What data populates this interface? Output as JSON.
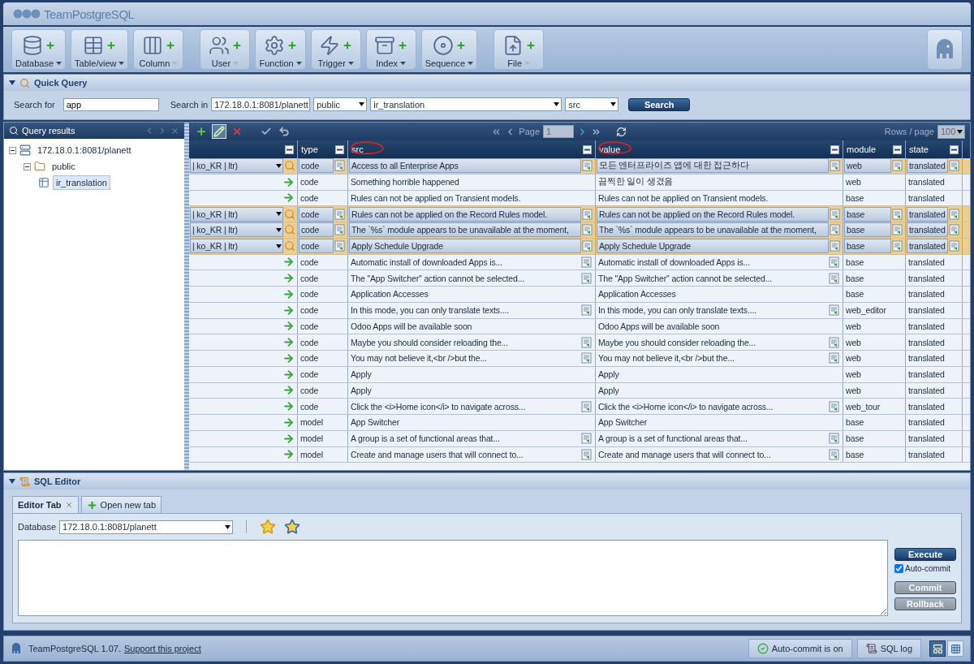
{
  "app": {
    "title": "TeamPostgreSQL"
  },
  "toolbar": [
    {
      "label": "Database",
      "menu_enabled": true
    },
    {
      "label": "Table/view",
      "menu_enabled": true
    },
    {
      "label": "Column",
      "menu_enabled": false
    },
    {
      "label": "User",
      "menu_enabled": false
    },
    {
      "label": "Function",
      "menu_enabled": true
    },
    {
      "label": "Trigger",
      "menu_enabled": true
    },
    {
      "label": "Index",
      "menu_enabled": true
    },
    {
      "label": "Sequence",
      "menu_enabled": true
    },
    {
      "label": "File",
      "menu_enabled": false
    }
  ],
  "quick_query": {
    "title": "Quick Query",
    "expanded": true,
    "search_for_label": "Search for",
    "search_for_value": "app",
    "search_in_label": "Search in",
    "selects": [
      "172.18.0.1:8081/planett",
      "public",
      "ir_translation",
      "src"
    ],
    "button": "Search"
  },
  "results_panel": {
    "title": "Query results",
    "tree": [
      {
        "label": "172.18.0.1:8081/planett",
        "kind": "server",
        "expanded": true,
        "selected": false,
        "children": [
          {
            "label": "public",
            "kind": "schema",
            "expanded": true,
            "selected": false,
            "children": [
              {
                "label": "ir_translation",
                "kind": "table",
                "selected": true
              }
            ]
          }
        ]
      }
    ]
  },
  "grid": {
    "tools": [
      {
        "kind": "add",
        "active": false
      },
      {
        "kind": "edit",
        "active": true
      },
      {
        "kind": "delete",
        "active": false
      },
      {
        "kind": "save",
        "active": false
      },
      {
        "kind": "undo",
        "active": false
      }
    ],
    "page_label": "Page",
    "page_value": "1",
    "rows_per_page_label": "Rows / page",
    "rows_per_page": "100",
    "columns": [
      {
        "label": "type",
        "circled": false
      },
      {
        "label": "src",
        "circled": true
      },
      {
        "label": "value",
        "circled": true
      },
      {
        "label": "module",
        "circled": false
      },
      {
        "label": "state",
        "circled": false
      }
    ],
    "rows": [
      {
        "editing": true,
        "locale": "| ko_KR | ltr)",
        "type": "code",
        "src": "Access to all Enterprise Apps",
        "value": "모든 엔터프라이즈 앱에 대한 접근하다",
        "module": "web",
        "state": "translated",
        "has_note": true
      },
      {
        "editing": false,
        "type": "code",
        "src": "Something horrible happened",
        "value": "끔찍한 일이 생겼음",
        "module": "web",
        "state": "translated",
        "has_note": false
      },
      {
        "editing": false,
        "type": "code",
        "src": "Rules can not be applied on Transient models.",
        "value": "Rules can not be applied on Transient models.",
        "module": "base",
        "state": "translated",
        "has_note": false
      },
      {
        "editing": true,
        "locale": "| ko_KR | ltr)",
        "type": "code",
        "src": "Rules can not be applied on the Record Rules model.",
        "value": "Rules can not be applied on the Record Rules model.",
        "module": "base",
        "state": "translated",
        "has_note": true
      },
      {
        "editing": true,
        "locale": "| ko_KR | ltr)",
        "type": "code",
        "src": "The `%s` module appears to be unavailable at the moment,",
        "value": "The `%s` module appears to be unavailable at the moment,",
        "module": "base",
        "state": "translated",
        "has_note": true
      },
      {
        "editing": true,
        "locale": "| ko_KR | ltr)",
        "type": "code",
        "src": "Apply Schedule Upgrade",
        "value": "Apply Schedule Upgrade",
        "module": "base",
        "state": "translated",
        "has_note": true
      },
      {
        "editing": false,
        "type": "code",
        "src": "Automatic install of downloaded Apps is...",
        "value": "Automatic install of downloaded Apps is...",
        "module": "base",
        "state": "translated",
        "has_note": true
      },
      {
        "editing": false,
        "type": "code",
        "src": "The \"App Switcher\" action cannot be selected...",
        "value": "The \"App Switcher\" action cannot be selected...",
        "module": "base",
        "state": "translated",
        "has_note": true
      },
      {
        "editing": false,
        "type": "code",
        "src": "Application Accesses",
        "value": "Application Accesses",
        "module": "base",
        "state": "translated",
        "has_note": false
      },
      {
        "editing": false,
        "type": "code",
        "src": "In this mode, you can only translate texts....",
        "value": "In this mode, you can only translate texts....",
        "module": "web_editor",
        "state": "translated",
        "has_note": true
      },
      {
        "editing": false,
        "type": "code",
        "src": "Odoo Apps will be available soon",
        "value": "Odoo Apps will be available soon",
        "module": "web",
        "state": "translated",
        "has_note": false
      },
      {
        "editing": false,
        "type": "code",
        "src": "Maybe you should consider reloading the...",
        "value": "Maybe you should consider reloading the...",
        "module": "web",
        "state": "translated",
        "has_note": true
      },
      {
        "editing": false,
        "type": "code",
        "src": "You may not believe it,<br />but the...",
        "value": "You may not believe it,<br />but the...",
        "module": "web",
        "state": "translated",
        "has_note": true
      },
      {
        "editing": false,
        "type": "code",
        "src": "Apply",
        "value": "Apply",
        "module": "web",
        "state": "translated",
        "has_note": false
      },
      {
        "editing": false,
        "type": "code",
        "src": "Apply",
        "value": "Apply",
        "module": "web",
        "state": "translated",
        "has_note": false
      },
      {
        "editing": false,
        "type": "code",
        "src": "Click the <i>Home icon</i> to navigate across...",
        "value": "Click the <i>Home icon</i> to navigate across...",
        "module": "web_tour",
        "state": "translated",
        "has_note": true
      },
      {
        "editing": false,
        "type": "model",
        "src": "App Switcher",
        "value": "App Switcher",
        "module": "base",
        "state": "translated",
        "has_note": false
      },
      {
        "editing": false,
        "type": "model",
        "src": "A group is a set of functional areas that...",
        "value": "A group is a set of functional areas that...",
        "module": "base",
        "state": "translated",
        "has_note": true
      },
      {
        "editing": false,
        "type": "model",
        "src": "Create and manage users that will connect to...",
        "value": "Create and manage users that will connect to...",
        "module": "base",
        "state": "translated",
        "has_note": true
      }
    ]
  },
  "sql_editor": {
    "title": "SQL Editor",
    "expanded": true,
    "tabs": [
      {
        "label": "Editor Tab",
        "kind": "editor",
        "selected": true
      },
      {
        "label": "Open new tab",
        "kind": "new",
        "selected": false
      }
    ],
    "database_label": "Database",
    "database": "172.18.0.1:8081/planett",
    "execute": "Execute",
    "auto_commit_label": "Auto-commit",
    "auto_commit": true,
    "commit": "Commit",
    "rollback": "Rollback",
    "commit_disabled": true
  },
  "status_bar": {
    "version": "TeamPostgreSQL 1.07.",
    "link": "Support this project",
    "auto_commit_status": "Auto-commit is on",
    "sql_log": "SQL log",
    "views": [
      {
        "kind": "split",
        "selected": true
      },
      {
        "kind": "grid",
        "selected": false
      }
    ]
  }
}
